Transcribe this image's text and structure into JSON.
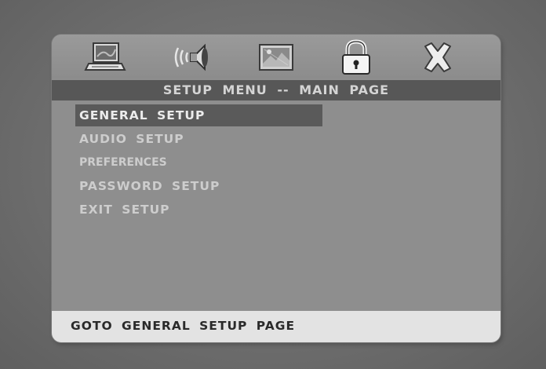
{
  "icons": [
    {
      "name": "general-setup-icon",
      "label": "laptop"
    },
    {
      "name": "audio-setup-icon",
      "label": "speaker"
    },
    {
      "name": "preferences-icon",
      "label": "picture"
    },
    {
      "name": "password-setup-icon",
      "label": "padlock"
    },
    {
      "name": "exit-setup-icon",
      "label": "close"
    }
  ],
  "header": {
    "title": "SETUP  MENU  --  MAIN  PAGE"
  },
  "menu": {
    "items": [
      {
        "label": "GENERAL  SETUP",
        "selected": true
      },
      {
        "label": "AUDIO  SETUP",
        "selected": false
      },
      {
        "label": "PREFERENCES",
        "selected": false
      },
      {
        "label": "PASSWORD  SETUP",
        "selected": false
      },
      {
        "label": "EXIT  SETUP",
        "selected": false
      }
    ]
  },
  "status": {
    "text": "GOTO  GENERAL  SETUP  PAGE"
  }
}
